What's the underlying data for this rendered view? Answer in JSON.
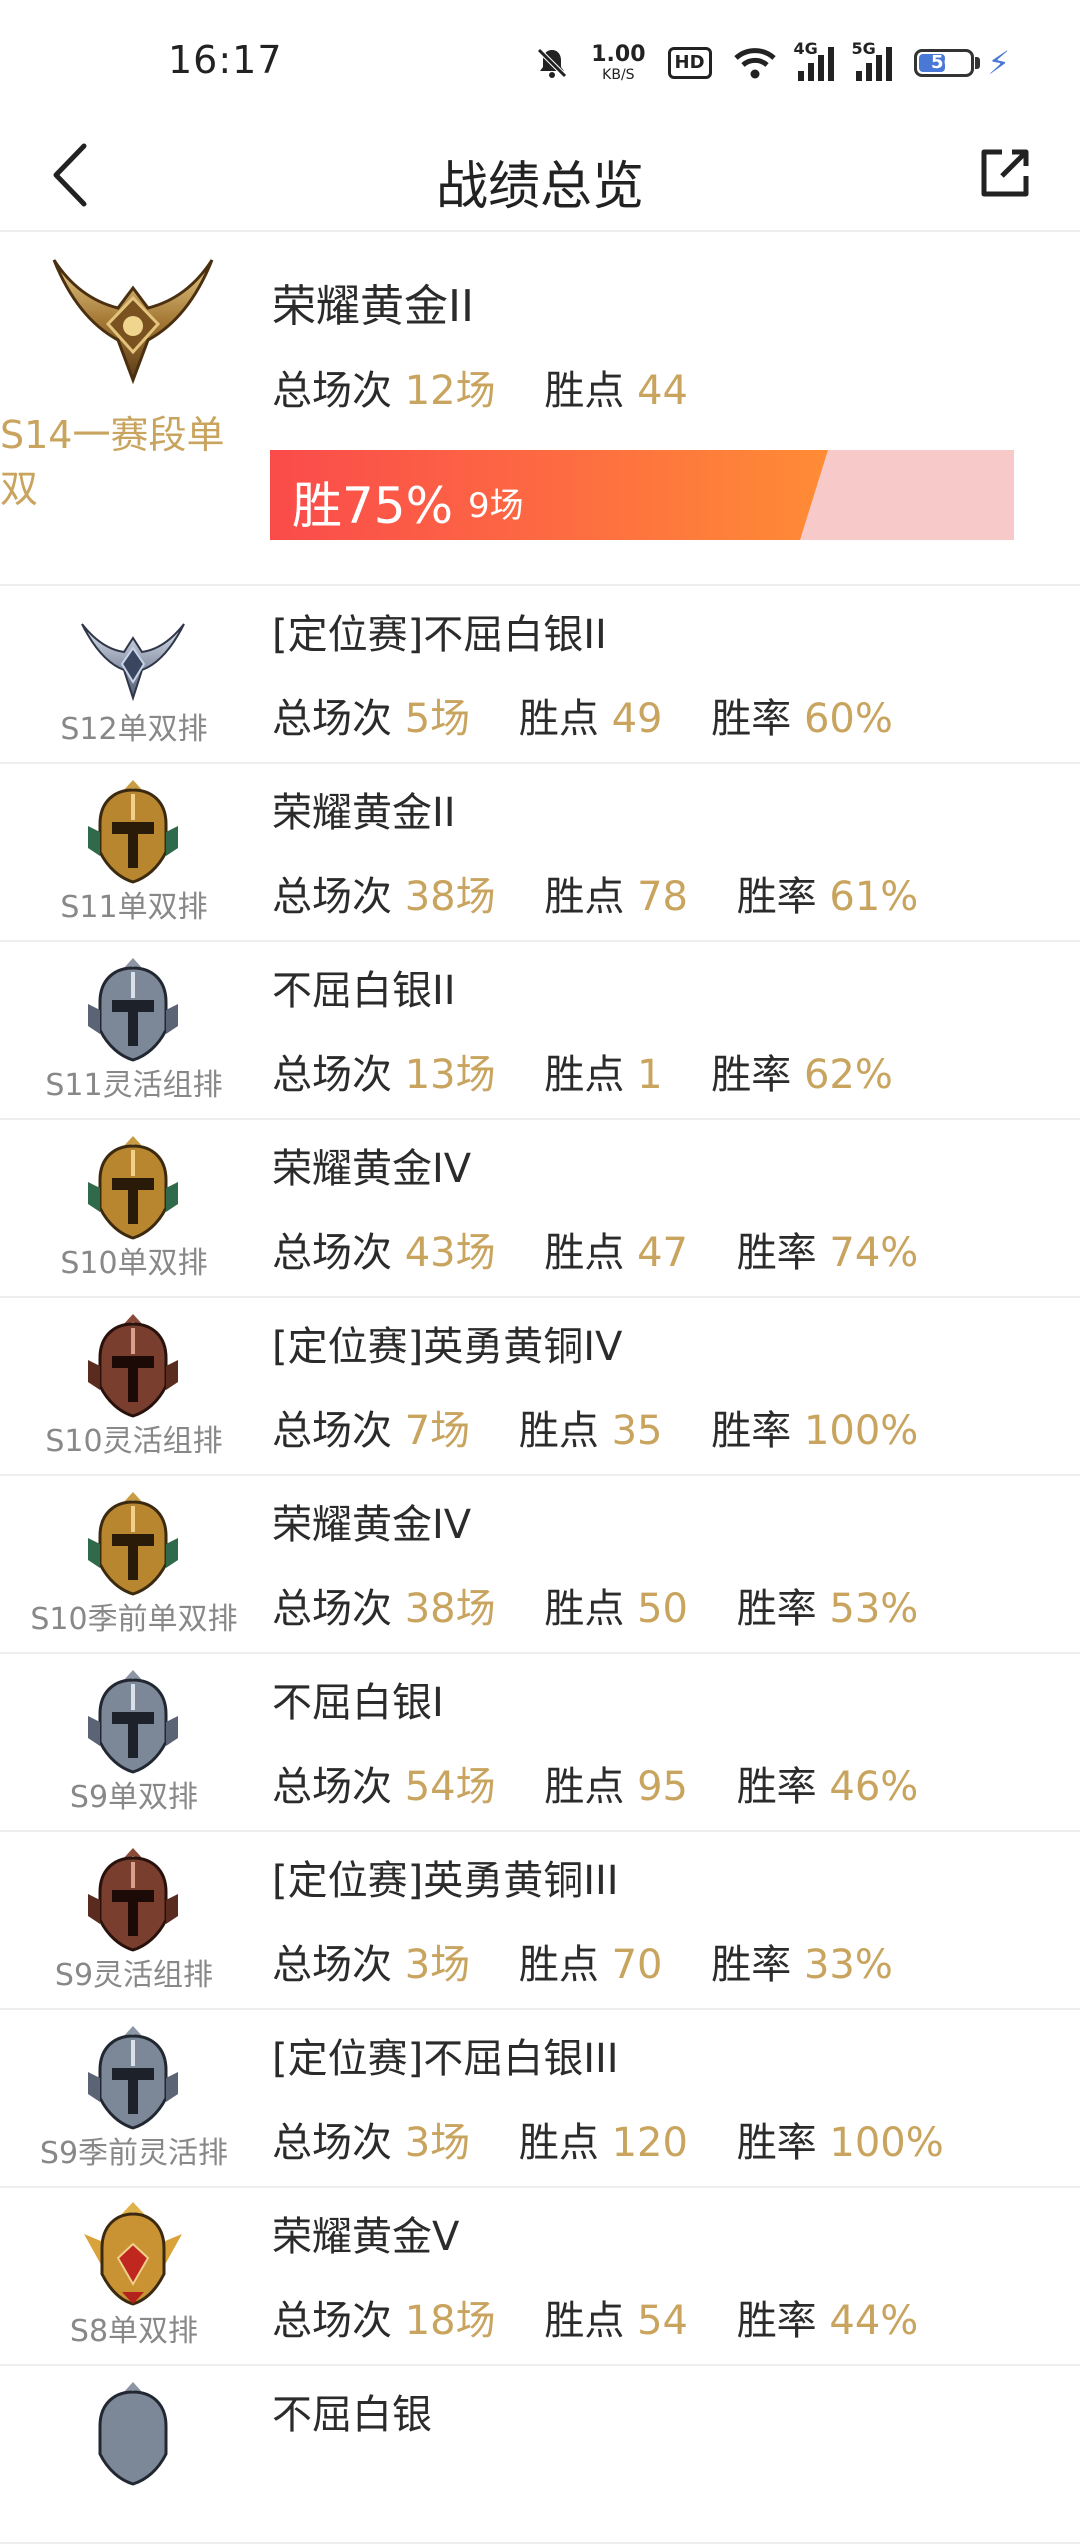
{
  "status_bar": {
    "time": "16:17",
    "net_speed_value": "1.00",
    "net_speed_unit": "KB/S",
    "hd_badge": "HD",
    "sig1_label": "4G",
    "sig2_label": "5G",
    "battery_level": "56",
    "icons": [
      "mute-icon",
      "wifi-icon",
      "charging-icon"
    ]
  },
  "header": {
    "title": "战绩总览",
    "back_icon": "chevron-left-icon",
    "share_icon": "share-external-icon"
  },
  "current": {
    "season": "S14一赛段单双",
    "rank": "荣耀黄金II",
    "games_label": "总场次",
    "games_value": "12场",
    "points_label": "胜点",
    "points_value": "44",
    "win_text": "胜75%",
    "win_count": "9场",
    "win_fraction": 0.75,
    "emblem": "gold-winged-emblem"
  },
  "labels": {
    "games": "总场次",
    "points": "胜点",
    "winrate": "胜率"
  },
  "history": [
    {
      "season": "S12单双排",
      "rank": "[定位赛]不屈白银II",
      "games": "5场",
      "points": "49",
      "winrate": "60%",
      "emblem": "silver-winged"
    },
    {
      "season": "S11单双排",
      "rank": "荣耀黄金II",
      "games": "38场",
      "points": "78",
      "winrate": "61%",
      "emblem": "gold-helmet"
    },
    {
      "season": "S11灵活组排",
      "rank": "不屈白银II",
      "games": "13场",
      "points": "1",
      "winrate": "62%",
      "emblem": "silver-helmet"
    },
    {
      "season": "S10单双排",
      "rank": "荣耀黄金IV",
      "games": "43场",
      "points": "47",
      "winrate": "74%",
      "emblem": "gold-helmet"
    },
    {
      "season": "S10灵活组排",
      "rank": "[定位赛]英勇黄铜IV",
      "games": "7场",
      "points": "35",
      "winrate": "100%",
      "emblem": "bronze-helmet"
    },
    {
      "season": "S10季前单双排",
      "rank": "荣耀黄金IV",
      "games": "38场",
      "points": "50",
      "winrate": "53%",
      "emblem": "gold-helmet"
    },
    {
      "season": "S9单双排",
      "rank": "不屈白银I",
      "games": "54场",
      "points": "95",
      "winrate": "46%",
      "emblem": "silver-helmet"
    },
    {
      "season": "S9灵活组排",
      "rank": "[定位赛]英勇黄铜III",
      "games": "3场",
      "points": "70",
      "winrate": "33%",
      "emblem": "bronze-helmet"
    },
    {
      "season": "S9季前灵活排",
      "rank": "[定位赛]不屈白银III",
      "games": "3场",
      "points": "120",
      "winrate": "100%",
      "emblem": "silver-helmet"
    },
    {
      "season": "S8单双排",
      "rank": "荣耀黄金V",
      "games": "18场",
      "points": "54",
      "winrate": "44%",
      "emblem": "gold-red-helmet"
    },
    {
      "season": "",
      "rank": "不屈白银",
      "games": "",
      "points": "",
      "winrate": "",
      "emblem": "silver-helmet"
    }
  ],
  "colors": {
    "accent_gold": "#c8a45e",
    "win_gradient_start": "#fa4b4b",
    "win_gradient_end": "#ff8c35",
    "loss_bg": "#f8c9c9"
  }
}
